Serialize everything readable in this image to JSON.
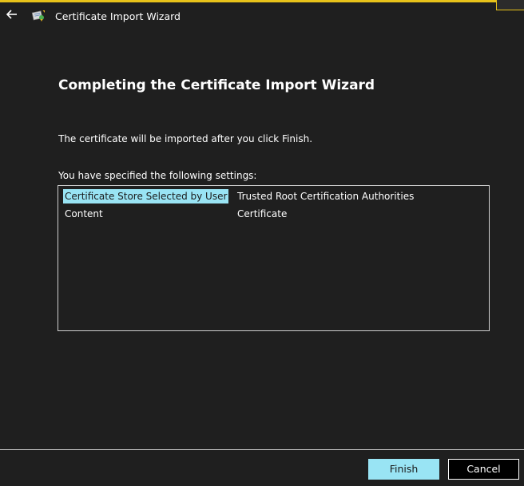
{
  "window": {
    "title": "Certificate Import Wizard",
    "back_icon": "back-arrow-icon",
    "app_icon": "certificate-icon"
  },
  "main": {
    "heading": "Completing the Certificate Import Wizard",
    "info": "The certificate will be imported after you click Finish.",
    "settings_label": "You have specified the following settings:",
    "settings": [
      {
        "name": "Certificate Store Selected by User",
        "value": "Trusted Root Certification Authorities",
        "selected": true
      },
      {
        "name": "Content",
        "value": "Certificate",
        "selected": false
      }
    ]
  },
  "footer": {
    "finish_label": "Finish",
    "cancel_label": "Cancel"
  },
  "colors": {
    "background": "#1f1f1f",
    "accent": "#99e4f4",
    "title_accent": "#e8c21a"
  }
}
